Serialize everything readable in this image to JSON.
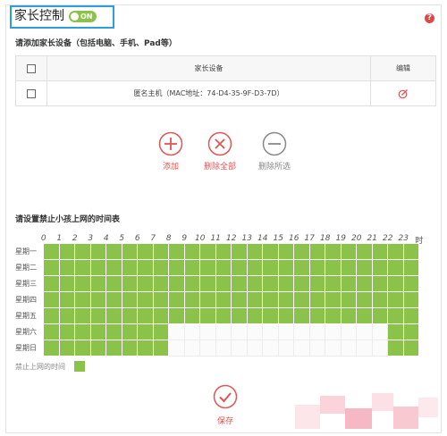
{
  "header": {
    "title": "家长控制",
    "toggle_label": "ON",
    "help_icon": "?"
  },
  "devices_section": {
    "label": "请添加家长设备（包括电脑、手机、Pad等）",
    "columns": [
      "家长设备",
      "编辑"
    ],
    "rows": [
      {
        "name": "匿名主机（MAC地址：74-D4-35-9F-D3-7D）"
      }
    ]
  },
  "actions": {
    "add_label": "添加",
    "delete_all_label": "删除全部",
    "delete_selected_label": "删除所选"
  },
  "schedule": {
    "label": "请设置禁止小孩上网的时间表",
    "hours": [
      "0",
      "1",
      "2",
      "3",
      "4",
      "5",
      "6",
      "7",
      "8",
      "9",
      "10",
      "11",
      "12",
      "13",
      "14",
      "15",
      "16",
      "17",
      "18",
      "19",
      "20",
      "21",
      "22",
      "23"
    ],
    "hour_suffix": "时",
    "days": [
      "星期一",
      "星期二",
      "星期三",
      "星期四",
      "星期五",
      "星期六",
      "星期日"
    ],
    "blocked": [
      [
        1,
        1,
        1,
        1,
        1,
        1,
        1,
        1,
        1,
        1,
        1,
        1,
        1,
        1,
        1,
        1,
        1,
        1,
        1,
        1,
        1,
        1,
        1,
        1
      ],
      [
        1,
        1,
        1,
        1,
        1,
        1,
        1,
        1,
        1,
        1,
        1,
        1,
        1,
        1,
        1,
        1,
        1,
        1,
        1,
        1,
        1,
        1,
        1,
        1
      ],
      [
        1,
        1,
        1,
        1,
        1,
        1,
        1,
        1,
        1,
        1,
        1,
        1,
        1,
        1,
        1,
        1,
        1,
        1,
        1,
        1,
        1,
        1,
        1,
        1
      ],
      [
        1,
        1,
        1,
        1,
        1,
        1,
        1,
        1,
        1,
        1,
        1,
        1,
        1,
        1,
        1,
        1,
        1,
        1,
        1,
        1,
        1,
        1,
        1,
        1
      ],
      [
        1,
        1,
        1,
        1,
        1,
        1,
        1,
        1,
        1,
        1,
        1,
        1,
        1,
        1,
        1,
        1,
        1,
        1,
        1,
        1,
        1,
        1,
        1,
        1
      ],
      [
        1,
        1,
        1,
        1,
        1,
        1,
        1,
        1,
        0,
        0,
        0,
        0,
        0,
        0,
        0,
        0,
        0,
        0,
        0,
        0,
        0,
        0,
        1,
        1
      ],
      [
        1,
        1,
        1,
        1,
        1,
        1,
        1,
        1,
        0,
        0,
        0,
        0,
        0,
        0,
        0,
        0,
        0,
        0,
        0,
        0,
        0,
        0,
        1,
        1
      ]
    ],
    "legend_label": "禁止上网的时间",
    "blocked_color": "#8bc34a"
  },
  "footer": {
    "save_label": "保存"
  },
  "colors": {
    "accent_red": "#e05555",
    "highlight_blue": "#2a9fd9",
    "toggle_green": "#8bc34a"
  }
}
